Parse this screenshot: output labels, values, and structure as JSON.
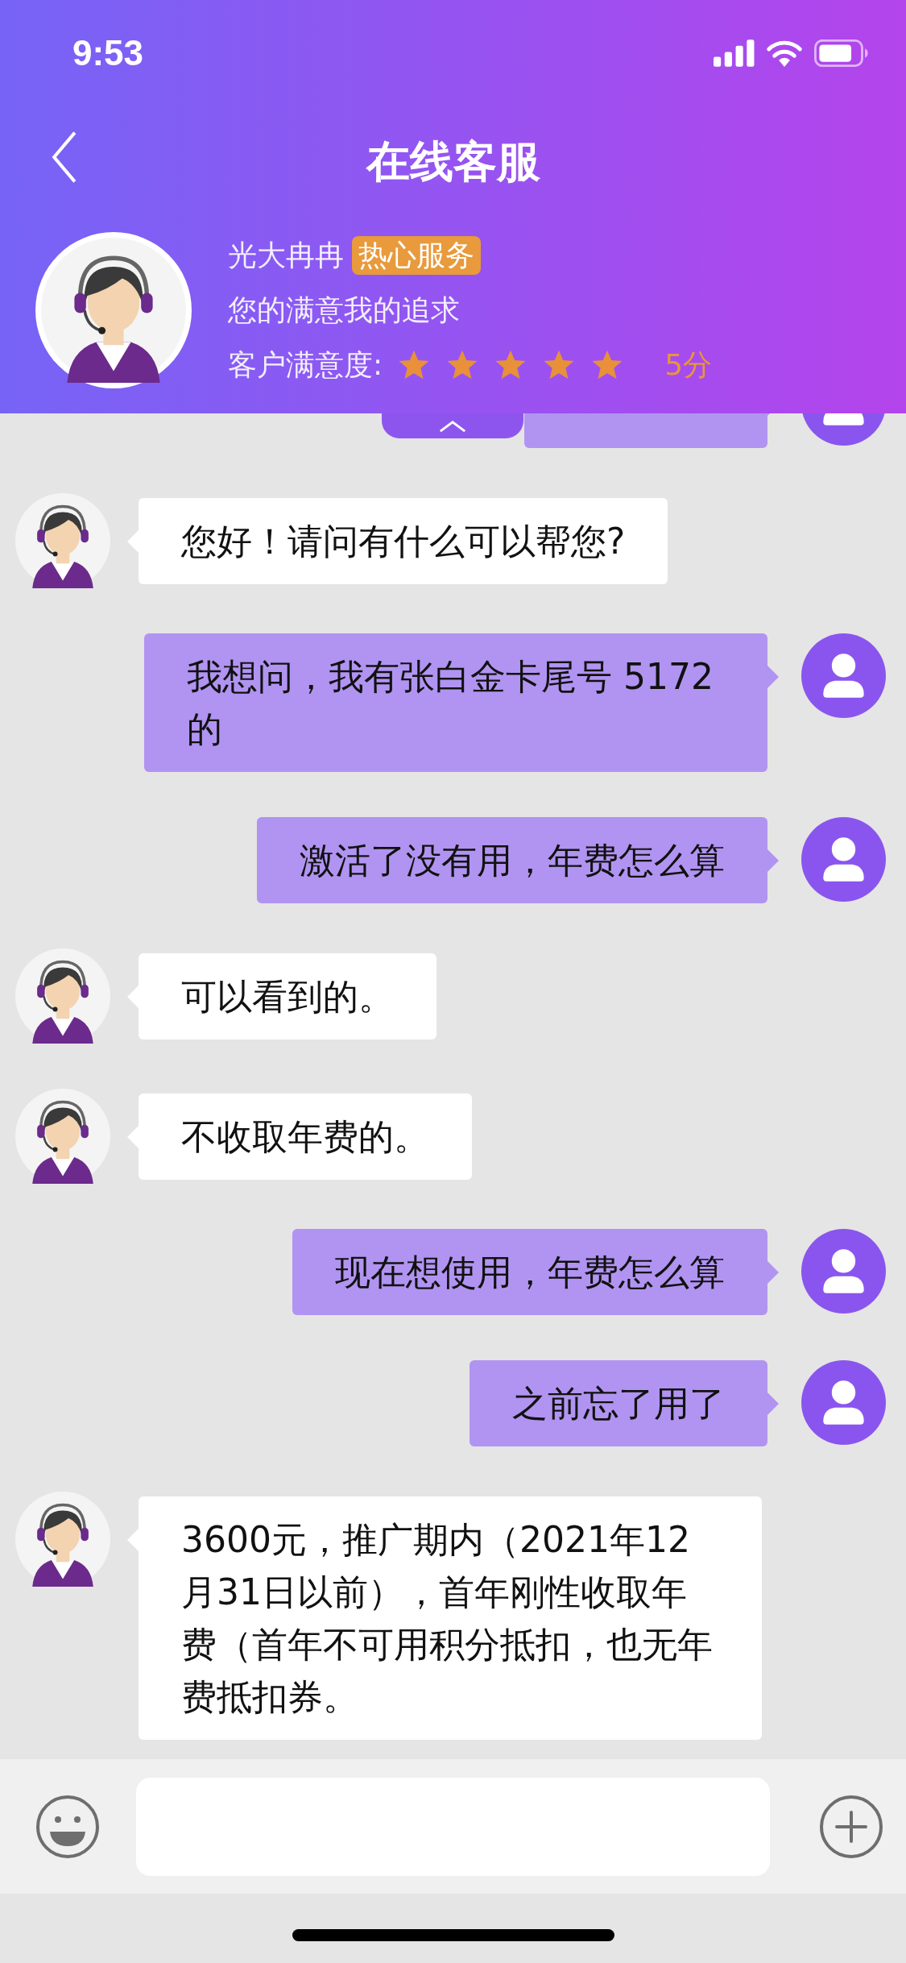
{
  "status_bar": {
    "time": "9:53"
  },
  "header": {
    "title": "在线客服"
  },
  "agent": {
    "name": "光大冉冉",
    "badge": "热心服务",
    "motto": "您的满意我的追求",
    "rating_label": "客户满意度:",
    "stars": 5,
    "score": "5分"
  },
  "messages": [
    {
      "kind": "user"
    },
    {
      "kind": "agent",
      "text": "您好！请问有什么可以帮您?"
    },
    {
      "kind": "user",
      "text": "我想问，我有张白金卡尾号 5172 的"
    },
    {
      "kind": "user",
      "text": "激活了没有用，年费怎么算"
    },
    {
      "kind": "agent",
      "text": "可以看到的。"
    },
    {
      "kind": "agent",
      "text": "不收取年费的。"
    },
    {
      "kind": "user",
      "text": "现在想使用，年费怎么算"
    },
    {
      "kind": "user",
      "text": "之前忘了用了"
    },
    {
      "kind": "agent",
      "text": "3600元，推广期内（2021年12月31日以前），首年刚性收取年费（首年不可用积分抵扣，也无年费抵扣券。"
    }
  ]
}
